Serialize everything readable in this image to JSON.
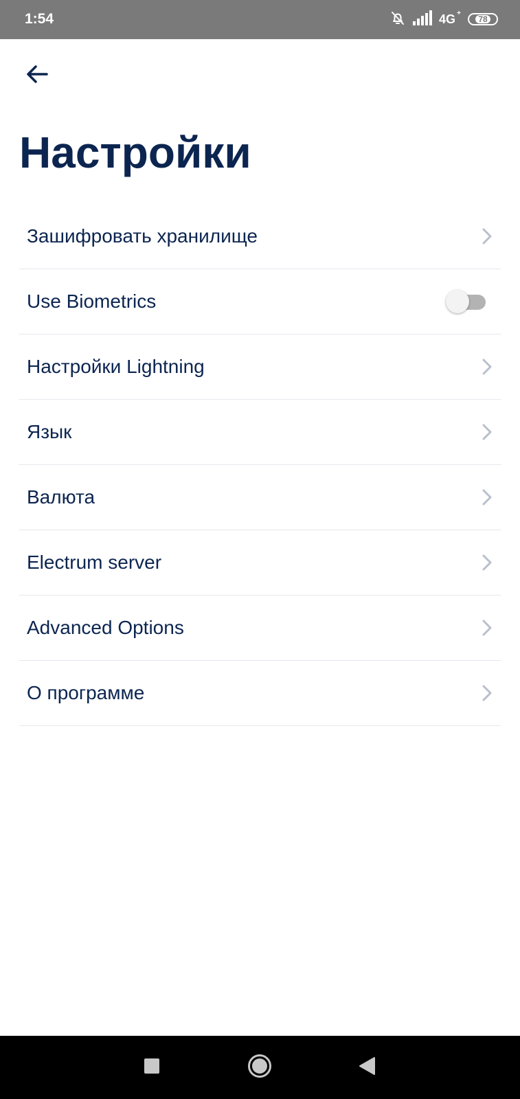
{
  "status_bar": {
    "time": "1:54",
    "network": "4G",
    "network_sup": "+",
    "battery": "78",
    "icons": [
      "bell-off-icon",
      "signal-icon",
      "battery-icon"
    ]
  },
  "header": {
    "back_icon": "arrow-left-icon",
    "title": "Настройки"
  },
  "settings": {
    "items": [
      {
        "label": "Зашифровать хранилище",
        "control": "chevron"
      },
      {
        "label": "Use Biometrics",
        "control": "toggle",
        "enabled": false
      },
      {
        "label": "Настройки Lightning",
        "control": "chevron"
      },
      {
        "label": "Язык",
        "control": "chevron"
      },
      {
        "label": "Валюта",
        "control": "chevron"
      },
      {
        "label": "Electrum server",
        "control": "chevron"
      },
      {
        "label": "Advanced Options",
        "control": "chevron"
      },
      {
        "label": "О программе",
        "control": "chevron"
      }
    ]
  },
  "nav_bar": {
    "buttons": [
      "recents-square-icon",
      "home-circle-icon",
      "back-triangle-icon"
    ]
  },
  "colors": {
    "title": "#0c2550",
    "text": "#0c2550",
    "chevron": "#b8bfcc",
    "divider": "#e6e8ee",
    "status_bar": "#7a7a7a",
    "nav_bar": "#000000"
  }
}
